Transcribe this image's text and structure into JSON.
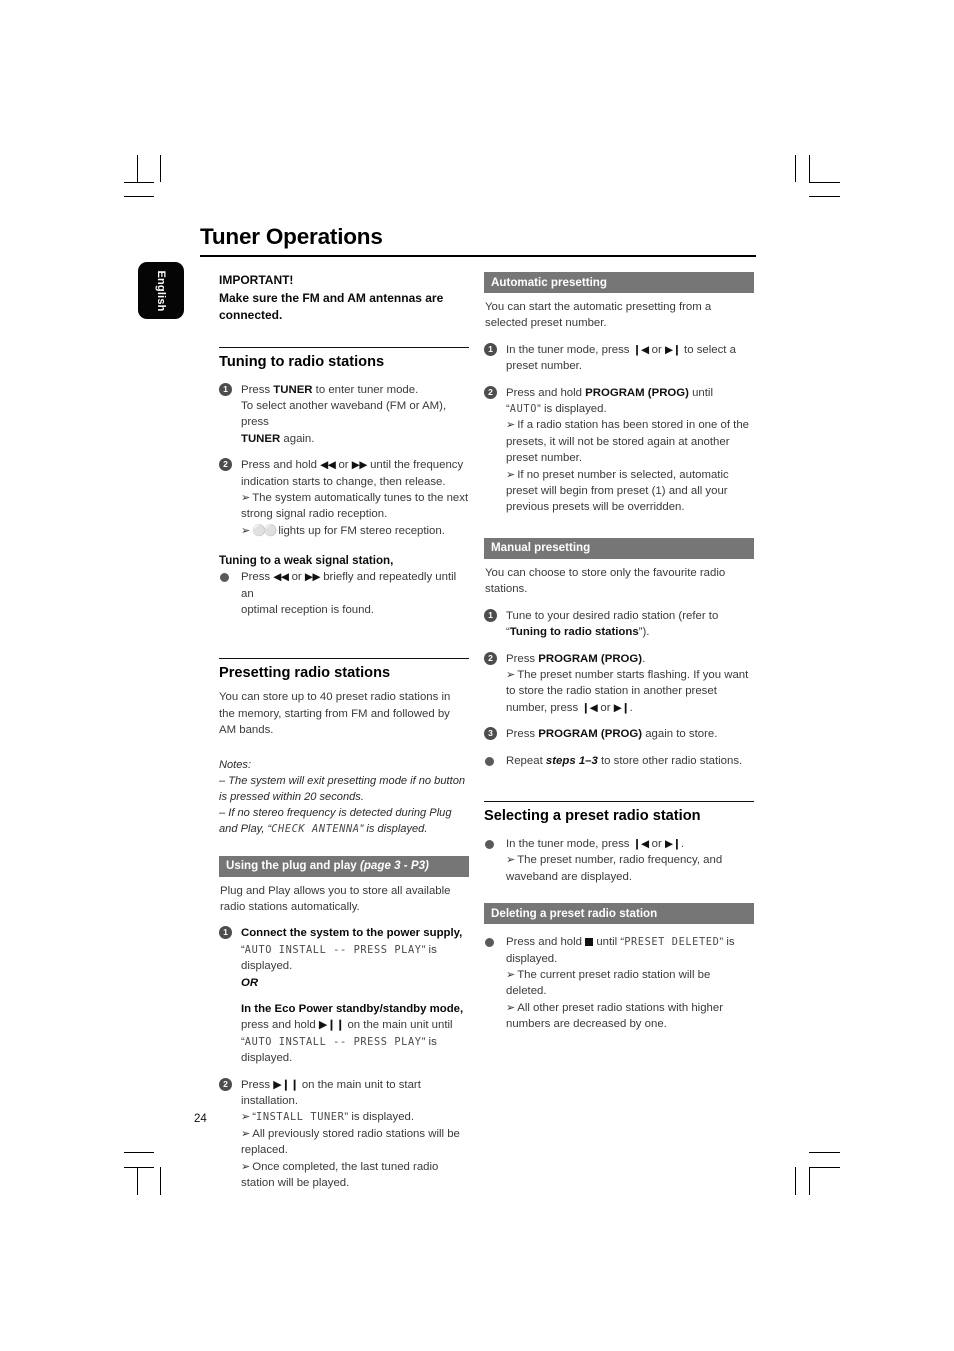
{
  "page": {
    "title": "Tuner Operations",
    "number": "24",
    "language_tab": "English"
  },
  "left_column": {
    "important": {
      "line1": "IMPORTANT!",
      "line2": "Make sure the FM and AM antennas are",
      "line3": "connected."
    },
    "tuning": {
      "heading": "Tuning to radio stations",
      "step1": {
        "num": "1",
        "a_pre": "Press ",
        "a_bold": "TUNER",
        "a_post": " to enter tuner mode.",
        "b": "To select another waveband (FM or AM), press",
        "c_bold": "TUNER",
        "c_post": " again."
      },
      "step2": {
        "num": "2",
        "a_pre": "Press and hold ",
        "a_glyph1": "◀◀",
        "a_mid": " or ",
        "a_glyph2": "▶▶",
        "a_post": " until the frequency",
        "b": "indication starts to change, then release.",
        "r1": "The system automatically tunes to the next strong signal radio reception.",
        "r2_pre": "",
        "r2_glyph": "∞",
        "r2_post": " lights up for FM stereo reception."
      },
      "weak": {
        "heading": "Tuning to a weak signal station,",
        "a_pre": "Press ",
        "a_glyph1": "◀◀",
        "a_mid": " or ",
        "a_glyph2": "▶▶",
        "a_post": " briefly and repeatedly until an",
        "b": "optimal reception is found."
      }
    },
    "presetting": {
      "heading": "Presetting radio stations",
      "intro": "You can store up to 40 preset radio stations in the memory, starting from FM and followed by AM bands.",
      "notes_label": "Notes:",
      "note1": "–  The system will exit presetting mode if no button is pressed within 20 seconds.",
      "note2_pre": "–  If no stereo frequency is detected during Plug and Play, “",
      "note2_lcd": "CHECK ANTENNA",
      "note2_post": "” is displayed."
    },
    "plug_and_play": {
      "header_main": "Using the plug and play ",
      "header_italic": "(page 3 - P3)",
      "intro": "Plug and Play allows you to store all available radio stations automatically.",
      "step1": {
        "num": "1",
        "bold": "Connect the system to the power supply,",
        "lcd_pre": "“",
        "lcd": "AUTO INSTALL -- PRESS PLAY",
        "lcd_post": "” is",
        "tail": "displayed.",
        "or": "OR",
        "bold2": "In the Eco Power standby/standby mode,",
        "b_pre": "press and hold ",
        "b_glyph": "▶❙❙",
        "b_post": " on the main unit until",
        "lcd2": "AUTO INSTALL -- PRESS PLAY",
        "lcd2_post": "” is",
        "tail2": "displayed."
      },
      "step2": {
        "num": "2",
        "a_pre": "Press ",
        "a_glyph": "▶❙❙",
        "a_post": " on the main unit to start installation.",
        "r1_pre": "“",
        "r1_lcd": "INSTALL TUNER",
        "r1_post": "” is displayed.",
        "r2": "All previously stored radio stations will be replaced.",
        "r3": "Once completed, the last tuned radio station will be played."
      }
    }
  },
  "right_column": {
    "auto_presetting": {
      "header": "Automatic presetting",
      "intro": "You can start the automatic presetting from a selected preset number.",
      "step1": {
        "num": "1",
        "a_pre": "In the tuner mode, press ",
        "a_glyph1": "❙◀",
        "a_mid": " or ",
        "a_glyph2": "▶❙",
        "a_post": " to select a",
        "b": "preset number."
      },
      "step2": {
        "num": "2",
        "a_pre": "Press and hold ",
        "a_bold": "PROGRAM (PROG)",
        "a_post": " until",
        "lcd_pre": "“",
        "lcd": "AUTO",
        "lcd_post": "” is displayed.",
        "r1": "If a radio station has been stored in one of the presets, it will not be stored again at another preset number.",
        "r2": "If no preset number is selected, automatic preset will begin from preset (1) and all your previous presets will be overridden."
      }
    },
    "manual_presetting": {
      "header": "Manual presetting",
      "intro": "You can choose to store only the favourite radio stations.",
      "step1": {
        "num": "1",
        "a": "Tune to your desired radio station (refer to",
        "b_pre": "“",
        "b_bold": "Tuning to radio stations",
        "b_post": "”)."
      },
      "step2": {
        "num": "2",
        "a_pre": "Press ",
        "a_bold": "PROGRAM (PROG)",
        "a_post": ".",
        "r1_pre": "The preset number starts flashing. If you want to store the radio station in another preset number, press ",
        "r1_glyph1": "❙◀",
        "r1_mid": " or ",
        "r1_glyph2": "▶❙",
        "r1_post": "."
      },
      "step3": {
        "num": "3",
        "a_pre": "Press ",
        "a_bold": "PROGRAM (PROG)",
        "a_post": " again to store."
      },
      "repeat": {
        "pre": "Repeat ",
        "bold": "steps 1–3",
        "post": " to store other radio stations."
      }
    },
    "selecting": {
      "heading": "Selecting a preset radio station",
      "bullet": {
        "a_pre": "In the tuner mode, press ",
        "a_glyph1": "❙◀",
        "a_mid": " or ",
        "a_glyph2": "▶❙",
        "a_post": ".",
        "r1": "The preset number, radio frequency, and waveband are displayed."
      }
    },
    "deleting": {
      "header": "Deleting a preset radio station",
      "bullet": {
        "a_pre": "Press and hold ",
        "a_mid": " until “",
        "a_lcd": "PRESET DELETED",
        "a_post": "” is",
        "b": "displayed.",
        "r1": "The current preset radio station will be deleted.",
        "r2": "All other preset radio stations with higher numbers are decreased by one."
      }
    }
  }
}
